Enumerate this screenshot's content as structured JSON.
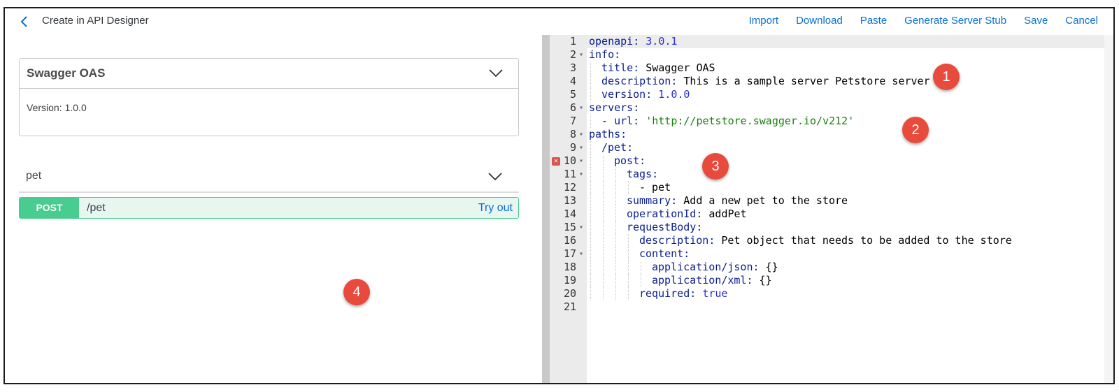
{
  "header": {
    "title": "Create in API Designer",
    "actions": [
      "Import",
      "Download",
      "Paste",
      "Generate Server Stub",
      "Save",
      "Cancel"
    ]
  },
  "info_card": {
    "title": "Swagger OAS",
    "version_label": "Version:",
    "version_value": "1.0.0"
  },
  "tag": {
    "name": "pet"
  },
  "operation": {
    "method": "POST",
    "path": "/pet",
    "try_out": "Try out"
  },
  "editor": {
    "lines": [
      {
        "n": "1",
        "fold": "",
        "indent": 0,
        "parts": [
          {
            "c": "k",
            "t": "openapi:"
          },
          {
            "c": "p",
            "t": " "
          },
          {
            "c": "b",
            "t": "3.0.1"
          }
        ]
      },
      {
        "n": "2",
        "fold": "▾",
        "indent": 0,
        "parts": [
          {
            "c": "k",
            "t": "info:"
          }
        ]
      },
      {
        "n": "3",
        "fold": "",
        "indent": 1,
        "parts": [
          {
            "c": "k",
            "t": "title:"
          },
          {
            "c": "p",
            "t": " Swagger OAS"
          }
        ]
      },
      {
        "n": "4",
        "fold": "",
        "indent": 1,
        "parts": [
          {
            "c": "k",
            "t": "description:"
          },
          {
            "c": "p",
            "t": " This is a sample server Petstore server"
          }
        ]
      },
      {
        "n": "5",
        "fold": "",
        "indent": 1,
        "parts": [
          {
            "c": "k",
            "t": "version:"
          },
          {
            "c": "p",
            "t": " "
          },
          {
            "c": "b",
            "t": "1.0.0"
          }
        ]
      },
      {
        "n": "6",
        "fold": "▾",
        "indent": 0,
        "parts": [
          {
            "c": "k",
            "t": "servers:"
          }
        ]
      },
      {
        "n": "7",
        "fold": "",
        "indent": 1,
        "parts": [
          {
            "c": "p",
            "t": "- "
          },
          {
            "c": "k",
            "t": "url:"
          },
          {
            "c": "p",
            "t": " "
          },
          {
            "c": "s",
            "t": "'http://petstore.swagger.io/v212'"
          }
        ]
      },
      {
        "n": "8",
        "fold": "▾",
        "indent": 0,
        "parts": [
          {
            "c": "k",
            "t": "paths:"
          }
        ]
      },
      {
        "n": "9",
        "fold": "▾",
        "indent": 1,
        "parts": [
          {
            "c": "k",
            "t": "/pet:"
          }
        ]
      },
      {
        "n": "10",
        "fold": "▾",
        "indent": 2,
        "error": true,
        "parts": [
          {
            "c": "k",
            "t": "post:"
          }
        ]
      },
      {
        "n": "11",
        "fold": "▾",
        "indent": 3,
        "parts": [
          {
            "c": "k",
            "t": "tags:"
          }
        ]
      },
      {
        "n": "12",
        "fold": "",
        "indent": 4,
        "parts": [
          {
            "c": "p",
            "t": "- pet"
          }
        ]
      },
      {
        "n": "13",
        "fold": "",
        "indent": 3,
        "parts": [
          {
            "c": "k",
            "t": "summary:"
          },
          {
            "c": "p",
            "t": " Add a new pet to the store"
          }
        ]
      },
      {
        "n": "14",
        "fold": "",
        "indent": 3,
        "parts": [
          {
            "c": "k",
            "t": "operationId:"
          },
          {
            "c": "p",
            "t": " addPet"
          }
        ]
      },
      {
        "n": "15",
        "fold": "▾",
        "indent": 3,
        "parts": [
          {
            "c": "k",
            "t": "requestBody:"
          }
        ]
      },
      {
        "n": "16",
        "fold": "",
        "indent": 4,
        "parts": [
          {
            "c": "k",
            "t": "description:"
          },
          {
            "c": "p",
            "t": " Pet object that needs to be added to the store"
          }
        ]
      },
      {
        "n": "17",
        "fold": "▾",
        "indent": 4,
        "parts": [
          {
            "c": "k",
            "t": "content:"
          }
        ]
      },
      {
        "n": "18",
        "fold": "",
        "indent": 5,
        "parts": [
          {
            "c": "k",
            "t": "application/json:"
          },
          {
            "c": "p",
            "t": " {}"
          }
        ]
      },
      {
        "n": "19",
        "fold": "",
        "indent": 5,
        "parts": [
          {
            "c": "k",
            "t": "application/xml:"
          },
          {
            "c": "p",
            "t": " {}"
          }
        ]
      },
      {
        "n": "20",
        "fold": "",
        "indent": 4,
        "parts": [
          {
            "c": "k",
            "t": "required:"
          },
          {
            "c": "p",
            "t": " "
          },
          {
            "c": "b",
            "t": "true"
          }
        ]
      },
      {
        "n": "21",
        "fold": "",
        "indent": 0,
        "parts": []
      }
    ]
  },
  "callouts": [
    "1",
    "2",
    "3",
    "4"
  ],
  "colors": {
    "accent": "#0a6ed1",
    "post_method": "#49cc90",
    "post_background": "#e8f6f0",
    "callout": "#e84a3c",
    "yaml_key": "#0b1e92",
    "yaml_string": "#1a7f0e",
    "yaml_number": "#2b2bd8"
  },
  "icons": {
    "back": "chevron-left-icon",
    "expand": "chevron-down-icon",
    "error": "error-marker-icon"
  }
}
